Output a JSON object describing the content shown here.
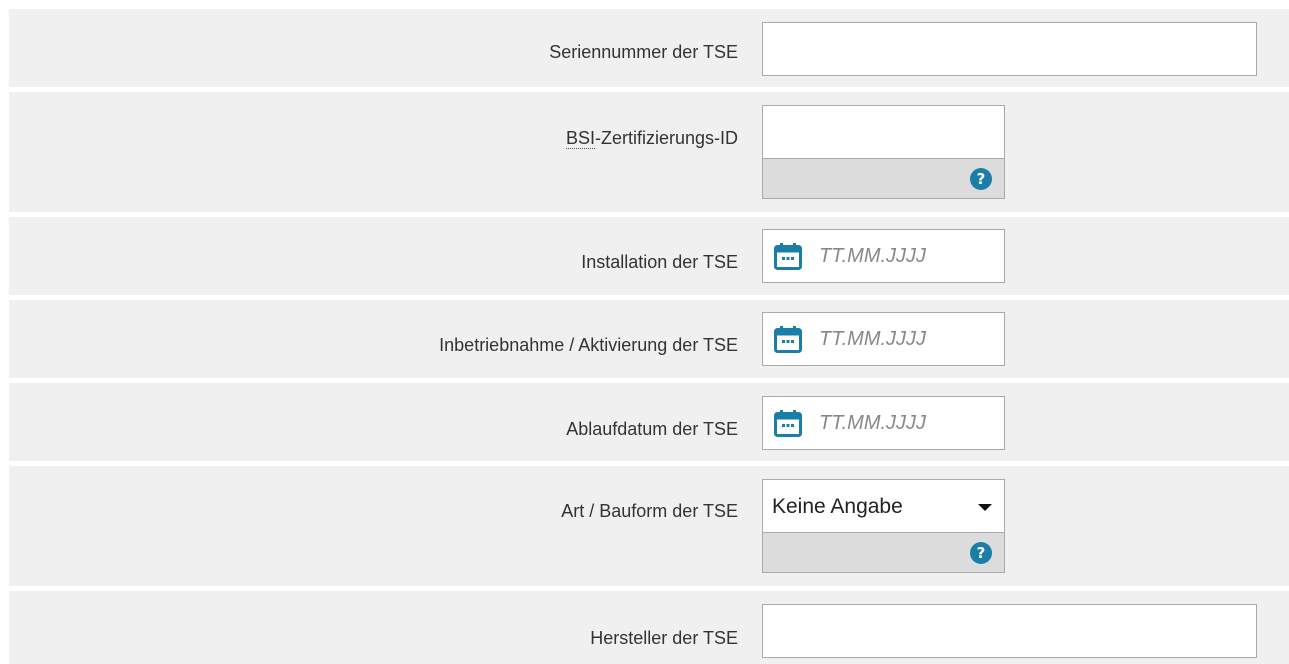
{
  "fields": {
    "serial": {
      "label": "Seriennummer der TSE",
      "value": ""
    },
    "bsi": {
      "label_abbr": "BSI",
      "label_rest": "-Zertifizierungs-ID",
      "value": "",
      "help_icon": "?"
    },
    "installation": {
      "label": "Installation der TSE",
      "placeholder": "TT.MM.JJJJ"
    },
    "activation": {
      "label": "Inbetriebnahme / Aktivierung der TSE",
      "placeholder": "TT.MM.JJJJ"
    },
    "expiry": {
      "label": "Ablaufdatum der TSE",
      "placeholder": "TT.MM.JJJJ"
    },
    "type": {
      "label": "Art / Bauform der TSE",
      "selected": "Keine Angabe",
      "help_icon": "?"
    },
    "manufacturer": {
      "label": "Hersteller der TSE",
      "value": ""
    }
  },
  "icons": {
    "calendar": "calendar-icon",
    "help": "help-icon",
    "dropdown": "chevron-down-icon"
  },
  "colors": {
    "row_background": "#f0f0f0",
    "help_bar": "#dcdcdc",
    "accent": "#1a7fa6",
    "placeholder": "#888888"
  }
}
